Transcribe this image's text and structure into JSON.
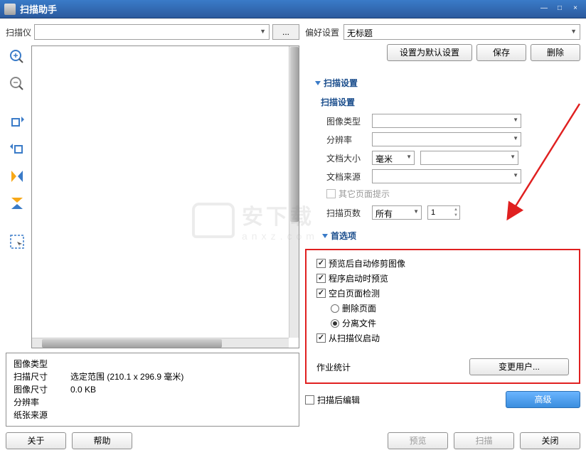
{
  "titlebar": {
    "title": "扫描助手"
  },
  "left": {
    "scanner_label": "扫描仪",
    "browse": "...",
    "info": {
      "image_type_label": "图像类型",
      "scan_size_label": "扫描尺寸",
      "scan_size_value": "选定范围 (210.1 x 296.9 毫米)",
      "image_size_label": "图像尺寸",
      "image_size_value": "0.0 KB",
      "resolution_label": "分辨率",
      "paper_source_label": "纸张来源"
    },
    "about": "关于",
    "help": "帮助"
  },
  "right": {
    "pref_label": "偏好设置",
    "pref_value": "无标题",
    "set_default": "设置为默认设置",
    "save": "保存",
    "delete": "删除",
    "scan_settings_header": "扫描设置",
    "scan_settings_sub": "扫描设置",
    "image_type_label": "图像类型",
    "resolution_label": "分辨率",
    "doc_size_label": "文档大小",
    "doc_size_unit": "毫米",
    "doc_source_label": "文档来源",
    "other_page_hint": "其它页面提示",
    "scan_pages_label": "扫描页数",
    "scan_pages_all": "所有",
    "scan_pages_num": "1",
    "prefs_header": "首选项",
    "auto_crop": "预览后自动修剪图像",
    "preview_on_start": "程序启动时预览",
    "blank_page_detect": "空白页面检测",
    "delete_page": "删除页面",
    "split_file": "分离文件",
    "start_from_scanner": "从扫描仪启动",
    "job_stats": "作业统计",
    "change_user": "变更用户...",
    "edit_after_scan": "扫描后编辑",
    "advanced": "高级",
    "preview": "预览",
    "scan": "扫描",
    "close": "关闭"
  }
}
